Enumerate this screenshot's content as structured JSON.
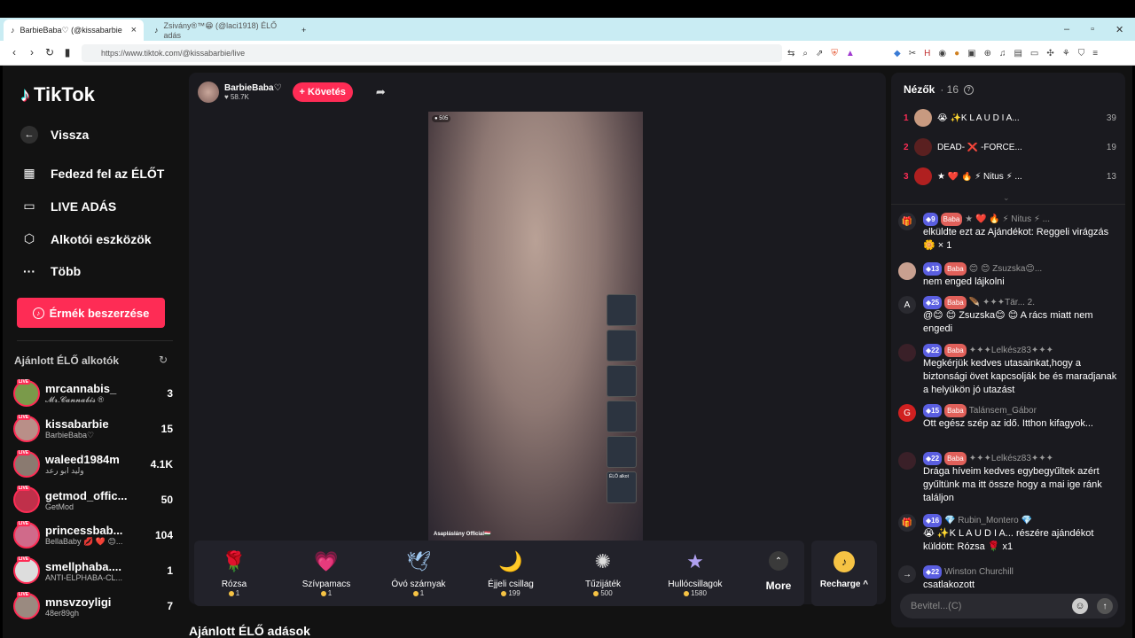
{
  "browser": {
    "tabs": [
      {
        "title": "BarbieBaba♡ (@kissabarbie",
        "active": true
      },
      {
        "title": "Zsivány®™😁 (@laci1918) ÉLŐ adás",
        "active": false
      }
    ],
    "new_tab": "+",
    "url": "https://www.tiktok.com/@kissabarbie/live"
  },
  "sidebar": {
    "logo": "TikTok",
    "back": "Vissza",
    "menu": [
      {
        "label": "Fedezd fel az ÉLŐT",
        "icon": "calendar-live-icon"
      },
      {
        "label": "LIVE ADÁS",
        "icon": "camera-icon"
      },
      {
        "label": "Alkotói eszközök",
        "icon": "creator-tools-icon"
      },
      {
        "label": "Több",
        "icon": "more-icon"
      }
    ],
    "coins_button": "Érmék beszerzése",
    "recommended_title": "Ajánlott ÉLŐ alkotók",
    "live_badge": "LIVE",
    "creators": [
      {
        "name": "mrcannabis_",
        "sub": "𝓜𝓻.𝓒𝓪𝓷𝓷𝓪𝓫𝓲𝓼 ®",
        "count": "3",
        "color": "#7a9a4a"
      },
      {
        "name": "kissabarbie",
        "sub": "BarbieBaba♡",
        "count": "15",
        "color": "#b98f88"
      },
      {
        "name": "waleed1984m",
        "sub": "وليد ابو رعد",
        "count": "4.1K",
        "color": "#8a7a70"
      },
      {
        "name": "getmod_offic...",
        "sub": "GetMod",
        "count": "50",
        "color": "#c0304a"
      },
      {
        "name": "princessbab...",
        "sub": "BellaBaby 💋 ❤️ 😊...",
        "count": "104",
        "color": "#d06a8a"
      },
      {
        "name": "smellphaba....",
        "sub": "ANTI-ELPHABA-CL...",
        "count": "1",
        "color": "#dddddd"
      },
      {
        "name": "mnsvzoyligi",
        "sub": "48er89gh",
        "count": "7",
        "color": "#9a8a80"
      }
    ]
  },
  "stream": {
    "host_name": "BarbieBaba♡",
    "host_likes": "♥ 58.7K",
    "follow_label": "+ Követés",
    "viewer_badge": "505",
    "caption": "Asapláslány Official🇭🇺",
    "minis": [
      "",
      "",
      "",
      "",
      "",
      "ÉLŐ alkot"
    ],
    "gifts": [
      {
        "name": "Rózsa",
        "price": "1",
        "icon": "🌹"
      },
      {
        "name": "Szívpamacs",
        "price": "1",
        "icon": "💗"
      },
      {
        "name": "Óvó szárnyak",
        "price": "1",
        "icon": "🕊"
      },
      {
        "name": "Éjjeli csillag",
        "price": "199",
        "icon": "🌙"
      },
      {
        "name": "Tűzijáték",
        "price": "500",
        "icon": "✺"
      },
      {
        "name": "Hullócsillagok",
        "price": "1580",
        "icon": "★"
      }
    ],
    "more_label": "More",
    "recharge_label": "Recharge ^"
  },
  "bottom_heading": "Ajánlott ÉLŐ adások",
  "chat": {
    "viewers_title": "Nézők",
    "viewers_count": "· 16",
    "top_viewers": [
      {
        "rank": "1",
        "name": "😭 ✨K L A U D I A...",
        "score": "39",
        "color": "#c89a80"
      },
      {
        "rank": "2",
        "name": "DEAD- ❌ -FORCE...",
        "score": "19",
        "color": "#5a2020"
      },
      {
        "rank": "3",
        "name": "★ ❤️ 🔥 ⚡ Nitus ⚡ ...",
        "score": "13",
        "color": "#b02020"
      }
    ],
    "messages": [
      {
        "level": "9",
        "fan": "Baba",
        "user": "★ ❤️ 🔥 ⚡ Nitus ⚡ ...",
        "text": "elküldte ezt az Ajándékot: Reggeli virágzás 🌼 × 1",
        "avatar": "#2a2a30",
        "icon": "🎁"
      },
      {
        "level": "13",
        "fan": "Baba",
        "user": "😊 😊 Zsuzska😊...",
        "text": "nem enged lájkolni",
        "avatar": "#c8a090",
        "icon": ""
      },
      {
        "level": "25",
        "fan": "Baba",
        "user": "🪶 ✦✦✦Tär... 2.",
        "text": "@😊 😊 Zsuzska😊 😊  A rács miatt nem engedi",
        "avatar": "#2a2a30",
        "icon": "A"
      },
      {
        "level": "22",
        "fan": "Baba",
        "user": "✦✦✦Lelkész83✦✦✦",
        "text": "Megkérjük kedves utasainkat,hogy a biztonsági övet kapcsolják be és maradjanak a helyükön jó utazást",
        "avatar": "#3a2028",
        "icon": ""
      },
      {
        "level": "15",
        "fan": "Baba",
        "user": "Talánsem_Gábor",
        "text": "Ott egész szép az idő. Itthon kifagyok...",
        "avatar": "#d02020",
        "icon": "G"
      },
      {
        "level": "22",
        "fan": "Baba",
        "user": "✦✦✦Lelkész83✦✦✦",
        "text": "Drága híveim kedves egybegyűltek azért gyűltünk ma itt össze hogy a mai ige ránk találjon",
        "avatar": "#3a2028",
        "icon": ""
      },
      {
        "level": "16",
        "fan": "",
        "user": "💎 Rubin_Montero 💎",
        "text": "😭 ✨K L A U D I A... részére ajándékot küldött: Rózsa 🌹 x1",
        "avatar": "#2a2a30",
        "icon": "🎁"
      },
      {
        "level": "22",
        "fan": "",
        "user": "Winston Churchill",
        "text": "csatlakozott",
        "avatar": "#2a2a30",
        "icon": "→"
      }
    ],
    "input_placeholder": "Bevitel...(C)"
  }
}
